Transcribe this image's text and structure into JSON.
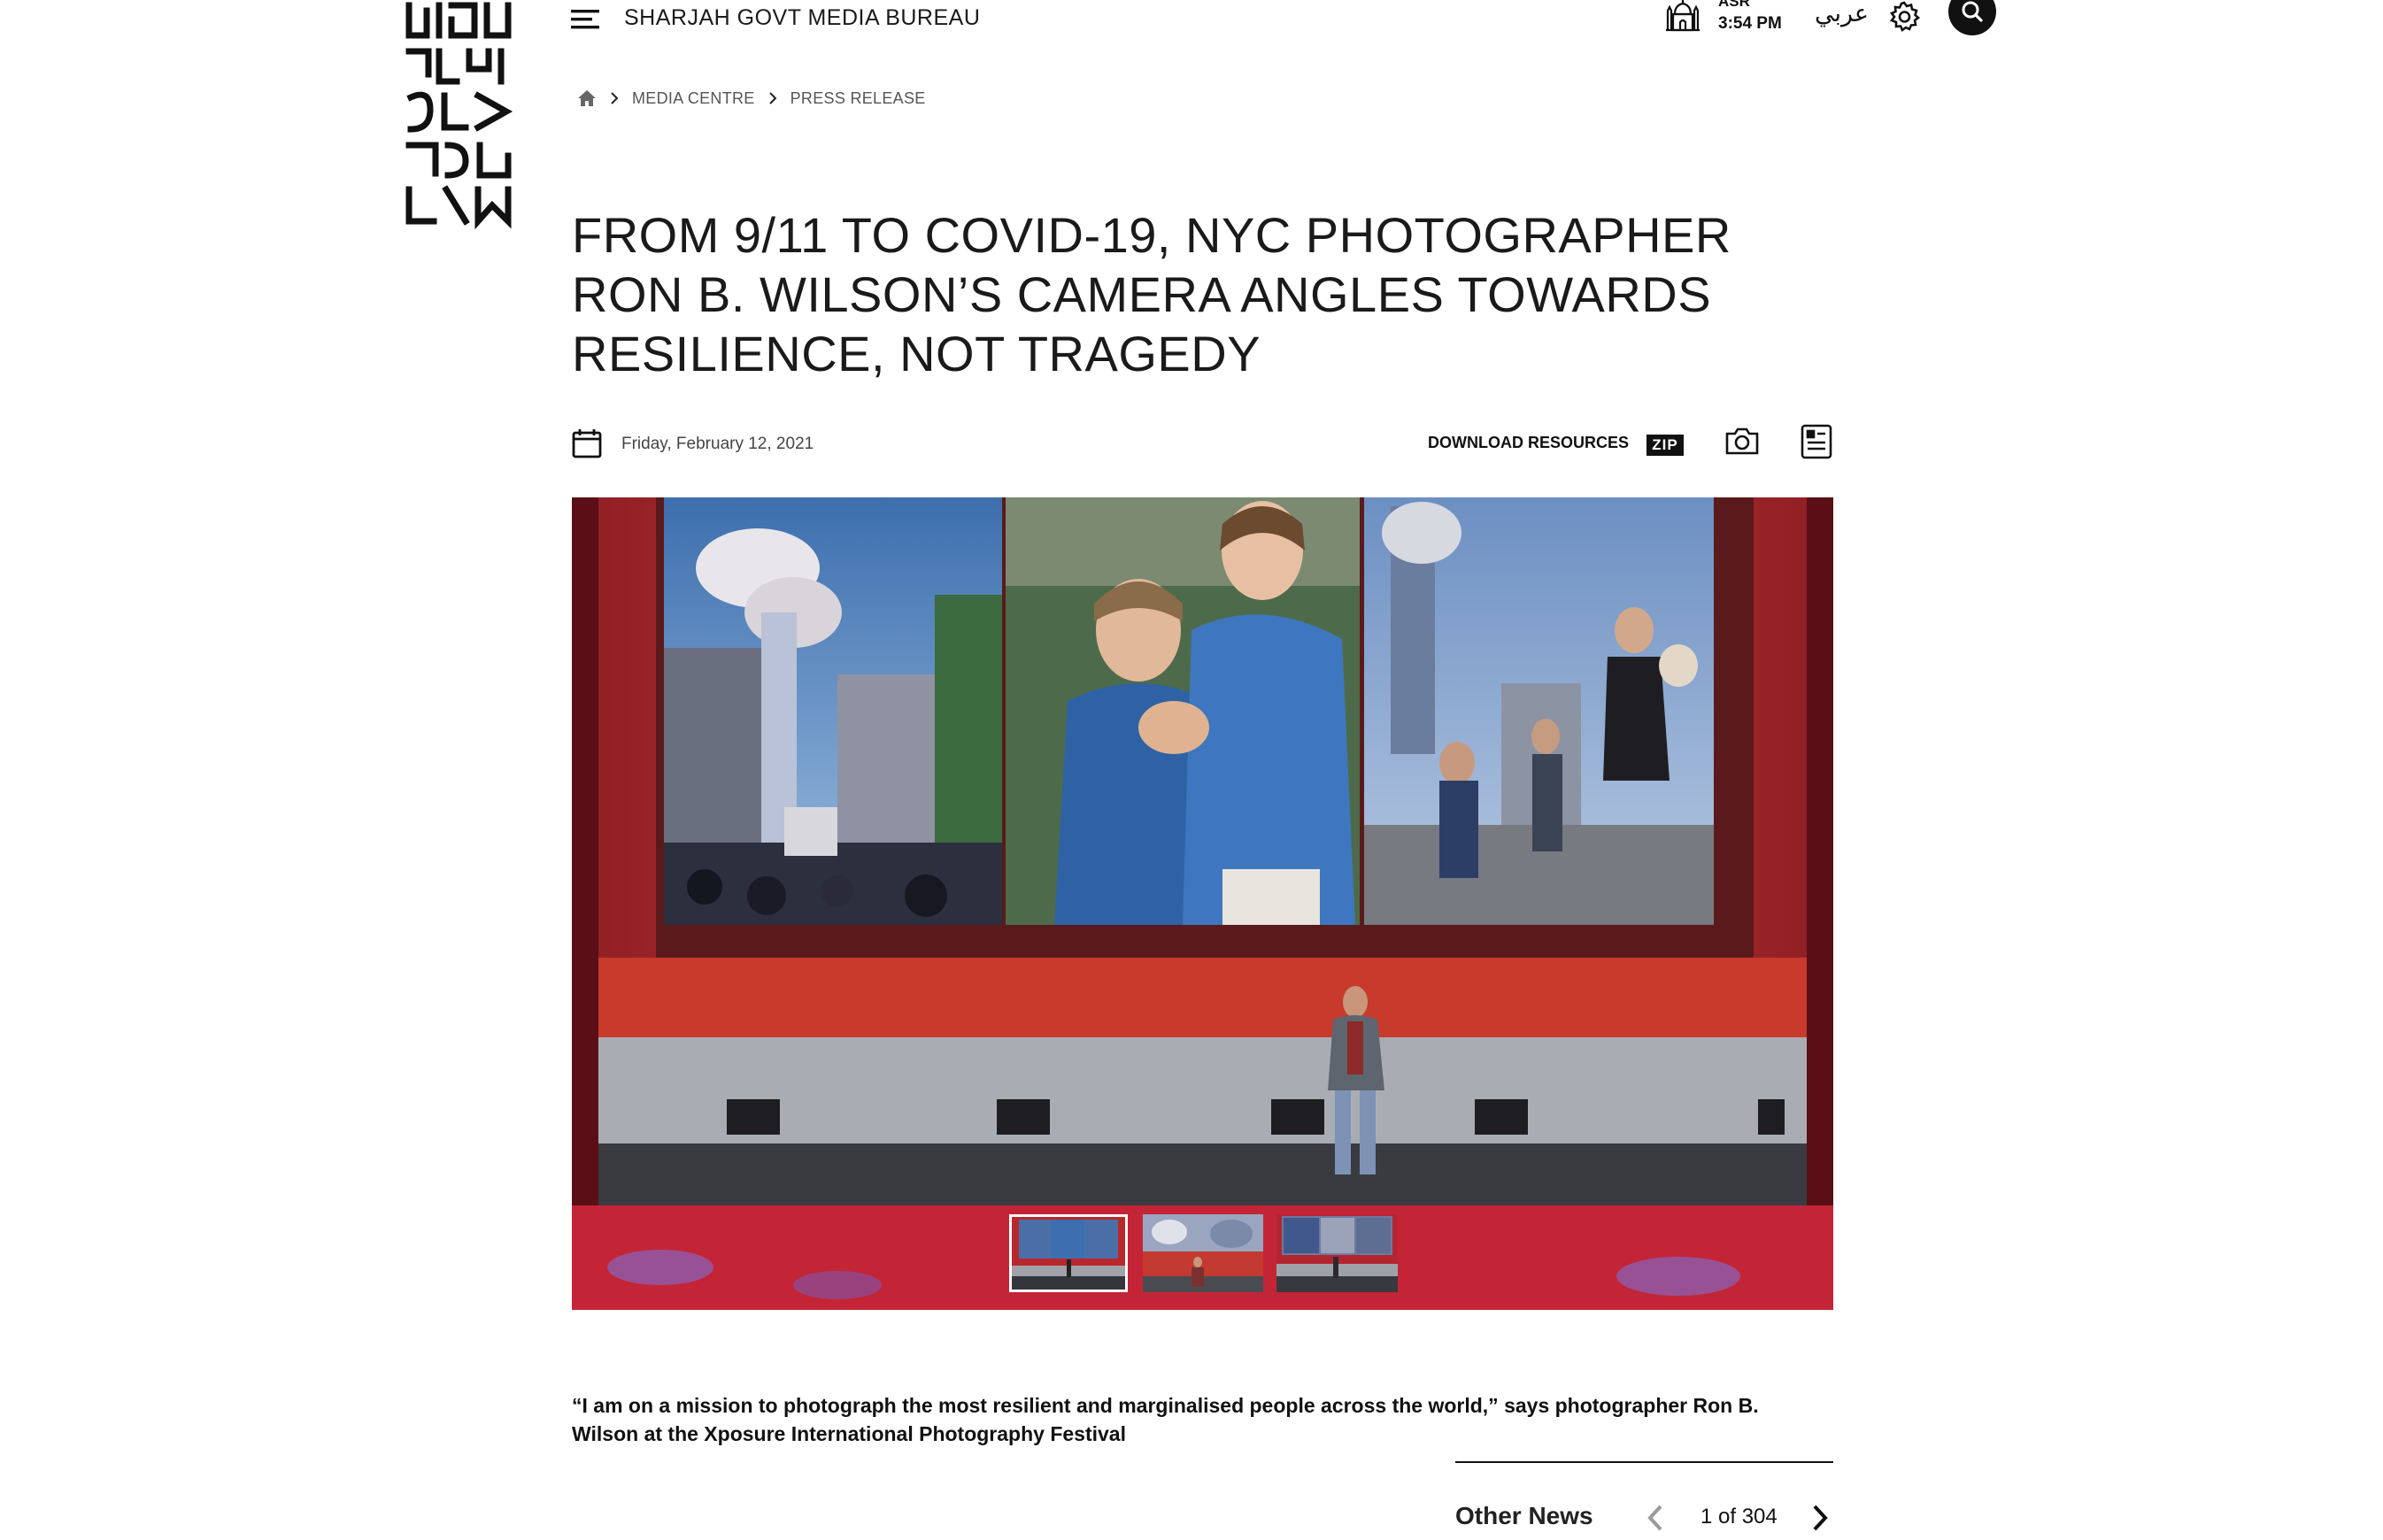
{
  "header": {
    "site_title": "SHARJAH GOVT MEDIA BUREAU",
    "prayer": {
      "name": "ASR",
      "time": "3:54 PM"
    },
    "language_link": "عربي"
  },
  "breadcrumb": {
    "items": [
      {
        "label": "MEDIA CENTRE"
      },
      {
        "label": "PRESS RELEASE"
      }
    ]
  },
  "article": {
    "title": "FROM 9/11 TO COVID-19, NYC PHOTOGRAPHER RON B. WILSON’S CAMERA ANGLES TOWARDS RESILIENCE, NOT TRAGEDY",
    "date": "Friday, February 12, 2021",
    "download_label": "DOWNLOAD RESOURCES",
    "zip_badge": "ZIP",
    "summary": "“I am on a mission to photograph the most resilient and marginalised people across the world,” says photographer Ron B. Wilson at the Xposure International Photography Festival"
  },
  "gallery": {
    "thumbnail_count": 3,
    "selected_index": 0
  },
  "other_news": {
    "label": "Other News",
    "page_indicator": "1 of 304"
  },
  "icons": {
    "menu": "hamburger-menu-icon",
    "mosque": "mosque-icon",
    "settings": "gear-icon",
    "search": "search-icon",
    "home": "home-icon",
    "calendar": "calendar-icon",
    "camera": "camera-icon",
    "document": "document-icon"
  },
  "colors": {
    "text": "#111111",
    "stage_red": "#c2332a",
    "background": "#ffffff"
  }
}
